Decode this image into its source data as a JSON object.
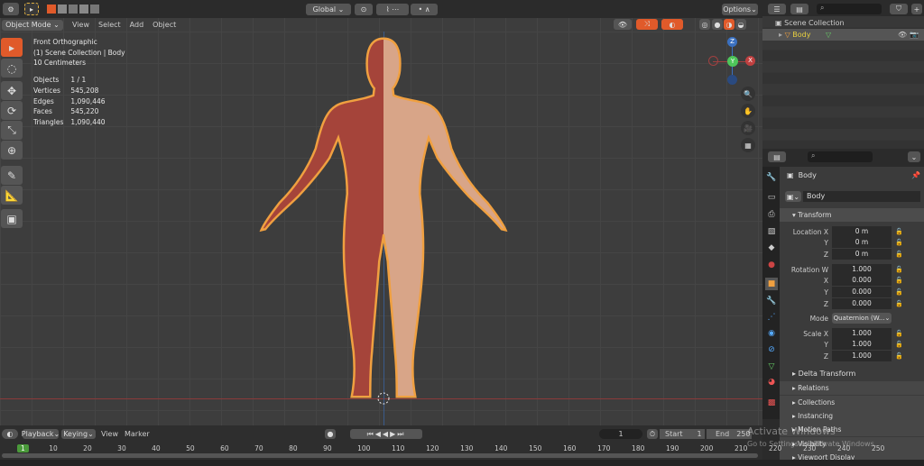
{
  "topbar": {
    "transform_orientation": "Global",
    "options": "Options"
  },
  "viewport_header": {
    "mode": "Object Mode",
    "menus": [
      "View",
      "Select",
      "Add",
      "Object"
    ]
  },
  "overlay_info": {
    "view": "Front Orthographic",
    "collection": "(1) Scene Collection | Body",
    "scale": "10 Centimeters",
    "stats": [
      {
        "label": "Objects",
        "value": "1 / 1"
      },
      {
        "label": "Vertices",
        "value": "545,208"
      },
      {
        "label": "Edges",
        "value": "1,090,446"
      },
      {
        "label": "Faces",
        "value": "545,220"
      },
      {
        "label": "Triangles",
        "value": "1,090,440"
      }
    ]
  },
  "gizmo": {
    "z": "Z",
    "y": "Y",
    "x": "X"
  },
  "outliner": {
    "root": "Scene Collection",
    "items": [
      {
        "name": "Body"
      }
    ]
  },
  "properties": {
    "object_name": "Body",
    "data_name": "Body",
    "transform_title": "Transform",
    "location": {
      "label": "Location X",
      "x": "0 m",
      "y": "0 m",
      "z": "0 m"
    },
    "rotation": {
      "label": "Rotation W",
      "w": "1.000",
      "x": "0.000",
      "y": "0.000",
      "z": "0.000"
    },
    "mode": {
      "label": "Mode",
      "value": "Quaternion (W..."
    },
    "scale": {
      "label": "Scale X",
      "x": "1.000",
      "y": "1.000",
      "z": "1.000"
    },
    "axis": {
      "y": "Y",
      "z": "Z",
      "x": "X"
    },
    "delta": "Delta Transform",
    "sections": [
      "Relations",
      "Collections",
      "Instancing",
      "Motion Paths",
      "Visibility",
      "Viewport Display"
    ]
  },
  "timeline": {
    "menus": [
      "Playback",
      "Keying",
      "View",
      "Marker"
    ],
    "current": "1",
    "start_label": "Start",
    "start": "1",
    "end_label": "End",
    "end": "250",
    "frames": [
      "1",
      "10",
      "20",
      "30",
      "40",
      "50",
      "60",
      "70",
      "80",
      "90",
      "100",
      "110",
      "120",
      "130",
      "140",
      "150",
      "160",
      "170",
      "180",
      "190",
      "200",
      "210",
      "220",
      "230",
      "240",
      "250"
    ]
  },
  "watermark": {
    "line1": "Activate Windows",
    "line2": "Go to Settings to activate Windows."
  }
}
